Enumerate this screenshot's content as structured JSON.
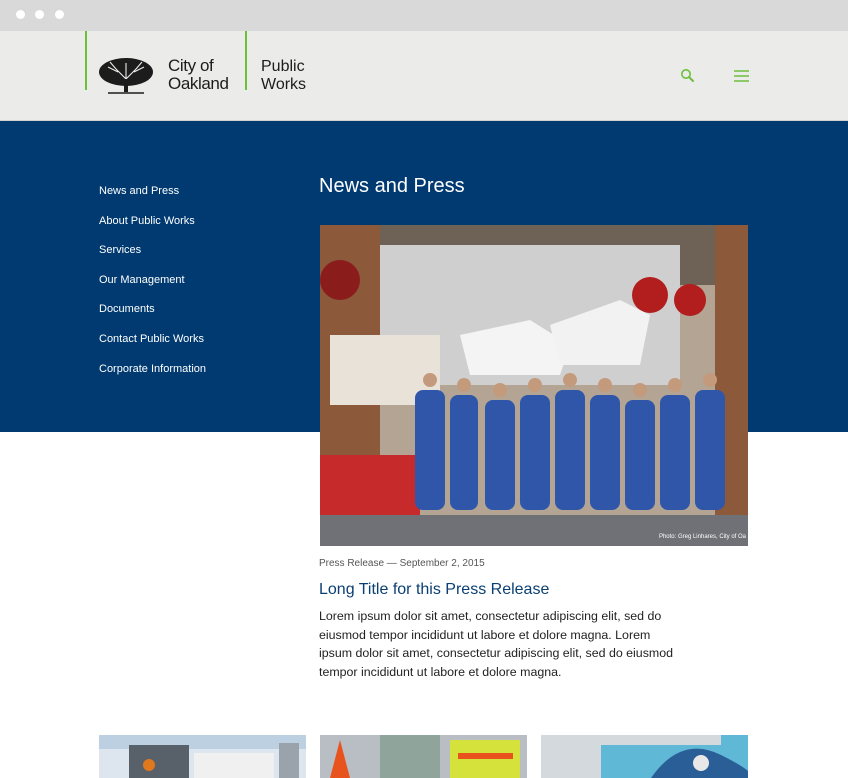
{
  "header": {
    "city_line1": "City of",
    "city_line2": "Oakland",
    "dept_line1": "Public",
    "dept_line2": "Works",
    "accent_color": "#6cbf3c",
    "search_icon": "search-icon",
    "menu_icon": "hamburger-menu-icon"
  },
  "colors": {
    "band": "#003a70",
    "header_bg": "#ebebe9",
    "link": "#0a3f73"
  },
  "sidebar": {
    "items": [
      {
        "label": "News and Press"
      },
      {
        "label": "About Public Works"
      },
      {
        "label": "Services"
      },
      {
        "label": "Our Management"
      },
      {
        "label": "Documents"
      },
      {
        "label": "Contact Public Works"
      },
      {
        "label": "Corporate Information"
      }
    ]
  },
  "main": {
    "title": "News and Press",
    "featured": {
      "photo_credit": "Photo: Greg Linhares, City of Oa",
      "meta": "Press Release — September 2, 2015",
      "title": "Long Title for this Press Release",
      "excerpt": "Lorem ipsum dolor sit amet, consectetur adipiscing elit, sed do eiusmod tempor incididunt ut labore et dolore magna. Lorem ipsum dolor sit amet, consectetur adipiscing elit, sed do eiusmod tempor incididunt ut labore et dolore magna."
    }
  }
}
